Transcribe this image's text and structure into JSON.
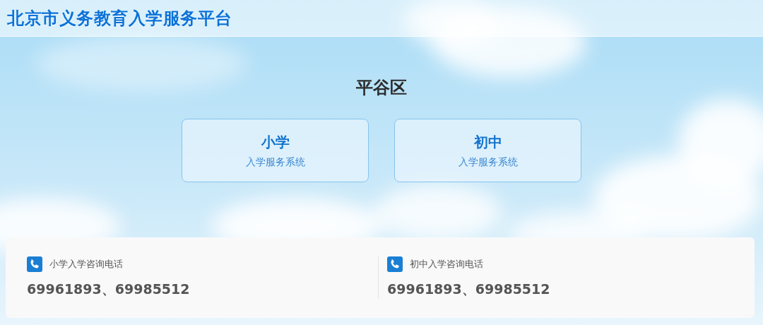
{
  "header": {
    "title": "北京市义务教育入学服务平台"
  },
  "district": "平谷区",
  "systems": [
    {
      "title": "小学",
      "subtitle": "入学服务系统"
    },
    {
      "title": "初中",
      "subtitle": "入学服务系统"
    }
  ],
  "contacts": [
    {
      "label": "小学入学咨询电话",
      "phones": "69961893、69985512"
    },
    {
      "label": "初中入学咨询电话",
      "phones": "69961893、69985512"
    }
  ]
}
